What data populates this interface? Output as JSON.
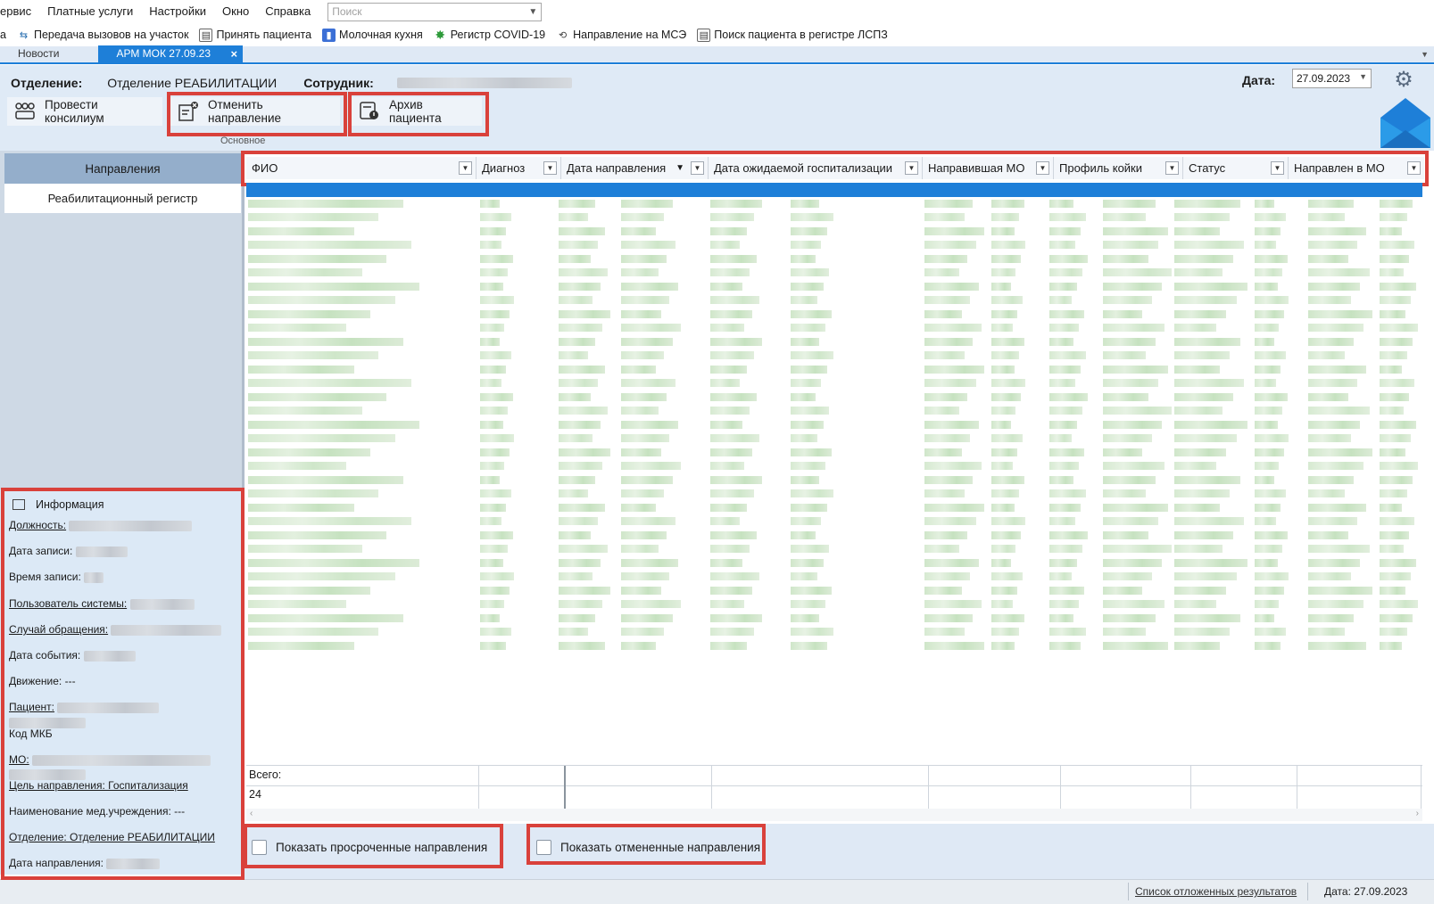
{
  "menu": {
    "items": [
      "ервис",
      "Платные услуги",
      "Настройки",
      "Окно",
      "Справка"
    ],
    "search_placeholder": "Поиск"
  },
  "quickbar": {
    "items": [
      {
        "label": "а",
        "icon": ""
      },
      {
        "label": "Передача вызовов на участок",
        "icon": "transfer-icon"
      },
      {
        "label": "Принять пациента",
        "icon": "accept-patient-icon"
      },
      {
        "label": "Молочная кухня",
        "icon": "milk-kitchen-icon"
      },
      {
        "label": "Регистр COVID-19",
        "icon": "covid-icon"
      },
      {
        "label": "Направление на МСЭ",
        "icon": "mse-icon"
      },
      {
        "label": "Поиск пациента в регистре ЛСПЗ",
        "icon": "search-patient-icon"
      }
    ]
  },
  "tabs": {
    "news": "Новости",
    "active": "АРМ МОК 27.09.23",
    "close": "×"
  },
  "header": {
    "department_label": "Отделение:",
    "department_value": "Отделение РЕАБИЛИТАЦИИ",
    "employee_label": "Сотрудник:",
    "date_label": "Дата:",
    "date_value": "27.09.2023"
  },
  "toolbar": {
    "consilium": "Провести консилиум",
    "cancel_direction": "Отменить направление",
    "patient_archive": "Архив пациента",
    "group_label": "Основное"
  },
  "sidebar": {
    "directions": "Направления",
    "rehab_registry": "Реабилитационный регистр"
  },
  "info": {
    "title": "Информация",
    "position": "Должность:",
    "record_date": "Дата записи:",
    "record_time": "Время записи:",
    "system_user": "Пользователь системы:",
    "case": "Случай обращения:",
    "event_date": "Дата события:",
    "movement": "Движение: ---",
    "patient": "Пациент:",
    "icd_code": "Код МКБ",
    "mo": "МО:",
    "purpose": "Цель направления: Госпитализация",
    "institution": "Наименование мед.учреждения: ---",
    "department": "Отделение: Отделение РЕАБИЛИТАЦИИ",
    "direction_date": "Дата направления:"
  },
  "grid": {
    "columns": [
      "ФИО",
      "Диагноз",
      "Дата направления",
      "Дата ожидаемой госпитализации",
      "Направившая МО",
      "Профиль койки",
      "Статус",
      "Направлен в МО"
    ],
    "total_label": "Всего:",
    "total_value": "24"
  },
  "filters": {
    "show_overdue": "Показать просроченные направления",
    "show_cancelled": "Показать отмененные направления"
  },
  "status": {
    "deferred_results": "Список отложенных результатов",
    "date": "Дата: 27.09.2023"
  },
  "colors": {
    "accent": "#1e7fd8",
    "highlight": "#d9413b",
    "panel": "#dfeaf6"
  }
}
